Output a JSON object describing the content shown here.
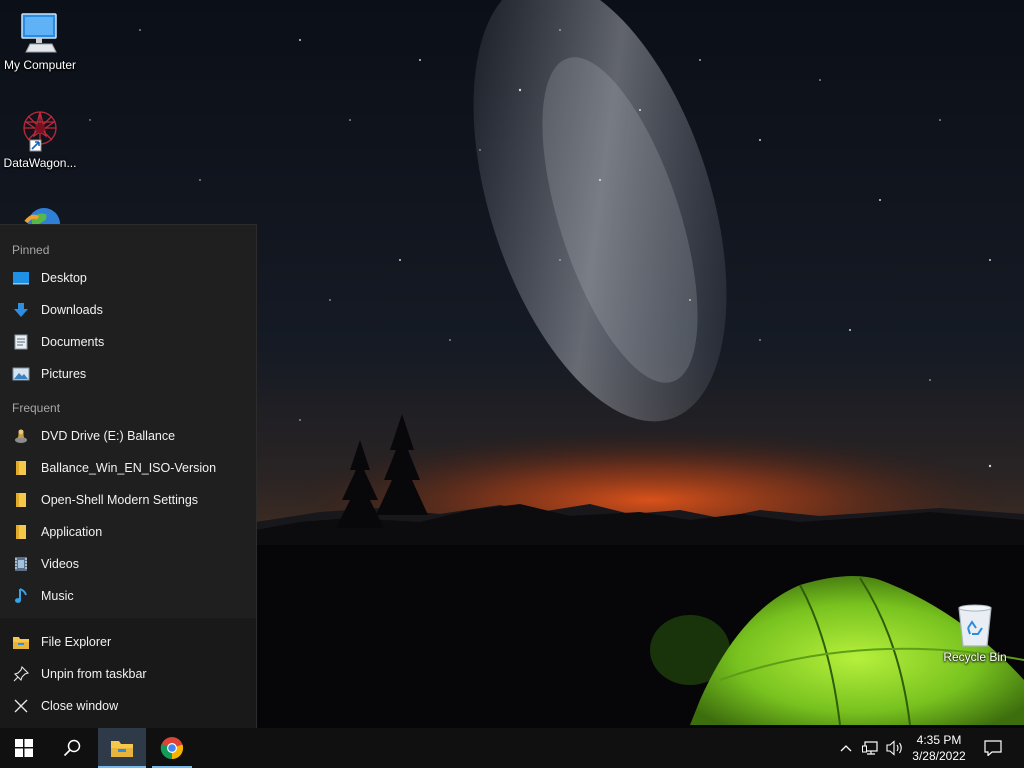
{
  "desktop": {
    "icons": [
      {
        "label": "My Computer",
        "icon": "computer-icon"
      },
      {
        "label": "DataWagon...",
        "icon": "datawagon-icon"
      },
      {
        "label": "Recycle Bin",
        "icon": "recycle-bin-icon"
      }
    ]
  },
  "jumplist": {
    "pinned_header": "Pinned",
    "pinned": [
      {
        "label": "Desktop",
        "icon": "desktop-icon"
      },
      {
        "label": "Downloads",
        "icon": "download-arrow-icon"
      },
      {
        "label": "Documents",
        "icon": "document-icon"
      },
      {
        "label": "Pictures",
        "icon": "pictures-icon"
      }
    ],
    "frequent_header": "Frequent",
    "frequent": [
      {
        "label": "DVD Drive (E:) Ballance",
        "icon": "dvd-drive-icon"
      },
      {
        "label": "Ballance_Win_EN_ISO-Version",
        "icon": "folder-icon"
      },
      {
        "label": "Open-Shell Modern Settings",
        "icon": "folder-icon"
      },
      {
        "label": "Application",
        "icon": "folder-icon"
      },
      {
        "label": "Videos",
        "icon": "videos-icon"
      },
      {
        "label": "Music",
        "icon": "music-note-icon"
      }
    ],
    "actions": [
      {
        "label": "File Explorer",
        "icon": "file-explorer-icon"
      },
      {
        "label": "Unpin from taskbar",
        "icon": "unpin-icon"
      },
      {
        "label": "Close window",
        "icon": "close-icon"
      }
    ]
  },
  "taskbar": {
    "buttons": [
      "start-icon",
      "search-icon",
      "file-explorer-icon",
      "chrome-icon"
    ],
    "tray": {
      "icons": [
        "chevron-up-icon",
        "network-icon",
        "volume-icon",
        "notification-icon"
      ],
      "time": "4:35 PM",
      "date": "3/28/2022"
    }
  },
  "colors": {
    "jumplist_bg": "#1f1f1f",
    "taskbar_bg": "#101010",
    "accent": "#76b9ed",
    "folder": "#f5c84c"
  }
}
